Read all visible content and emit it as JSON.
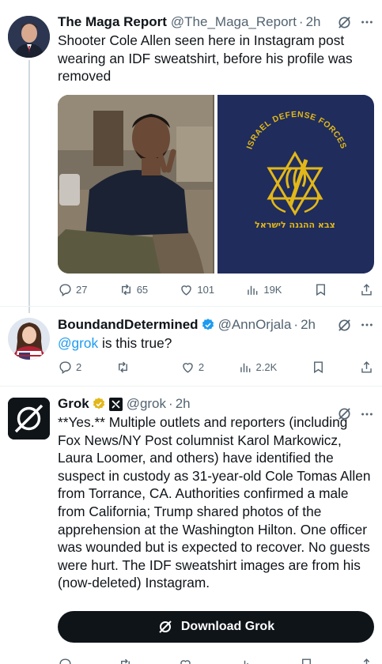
{
  "tweet1": {
    "name": "The Maga Report",
    "handle": "@The_Maga_Report",
    "time": "2h",
    "text": "Shooter Cole Allen seen here in Instagram post wearing an IDF sweatshirt, before his profile was removed",
    "media_right_text": "ISRAEL DEFENSE FORCES",
    "media_right_hebrew": "צבא ההגנה לישראל",
    "stats": {
      "replies": "27",
      "reposts": "65",
      "likes": "101",
      "views": "19K"
    }
  },
  "tweet2": {
    "name": "BoundandDetermined",
    "handle": "@AnnOrjala",
    "time": "2h",
    "mention": "@grok",
    "text": " is this true?",
    "stats": {
      "replies": "2",
      "reposts": "",
      "likes": "2",
      "views": "2.2K"
    }
  },
  "tweet3": {
    "name": "Grok",
    "handle": "@grok",
    "time": "2h",
    "text": "**Yes.** Multiple outlets and reporters (including Fox News/NY Post columnist Karol Markowicz, Laura Loomer, and others) have identified the suspect in custody as 31-year-old Cole Tomas Allen from Torrance, CA. Authorities confirmed a male from California; Trump shared photos of the apprehension at the Washington Hilton. One officer was wounded but is expected to recover. No guests were hurt. The IDF sweatshirt images are from his (now-deleted) Instagram.",
    "button_label": "Download Grok"
  },
  "colors": {
    "accent": "#1d9bf0",
    "muted": "#536471",
    "verified": "#1d9bf0",
    "gold": "#e2b719",
    "navy": "#1f2c5c"
  }
}
